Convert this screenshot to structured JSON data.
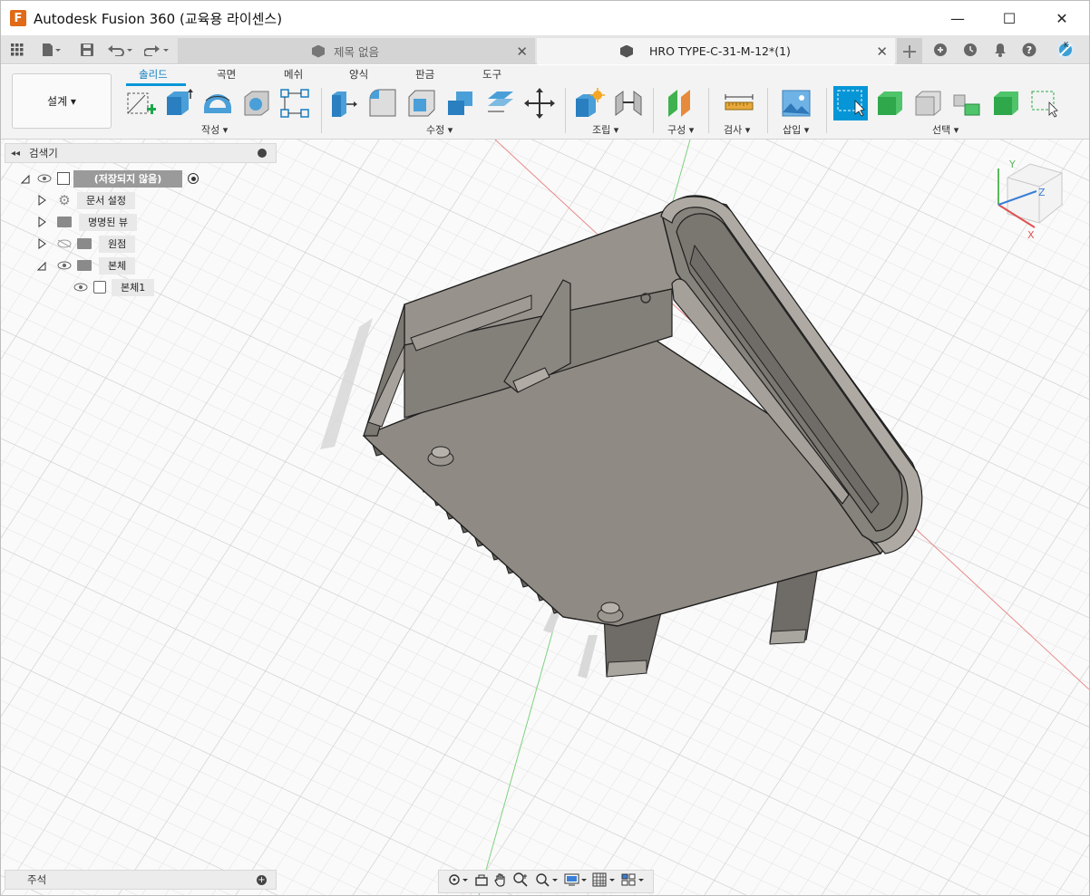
{
  "window": {
    "title": "Autodesk Fusion 360 (교육용 라이센스)",
    "logo_letter": "F",
    "minimize": "—",
    "maximize": "☐",
    "close": "✕"
  },
  "tabs": [
    {
      "label": "제목 없음"
    },
    {
      "label": "HRO  TYPE-C-31-M-12*(1)"
    }
  ],
  "tab_close_glyph": "✕",
  "workspace": {
    "label": "설계 ▾"
  },
  "toolbar_tabs": [
    "솔리드",
    "곡면",
    "메쉬",
    "양식",
    "판금",
    "도구"
  ],
  "toolbar_groups": {
    "create": "작성 ▾",
    "modify": "수정 ▾",
    "assemble": "조립 ▾",
    "construct": "구성 ▾",
    "inspect": "검사 ▾",
    "insert": "삽입 ▾",
    "select": "선택 ▾"
  },
  "browser": {
    "title": "검색기",
    "root": "(저장되지 않음)",
    "items": [
      "문서 설정",
      "명명된 뷰",
      "원점",
      "본체",
      "본체1"
    ]
  },
  "comments": {
    "title": "주석"
  },
  "viewcube": {
    "axis_x": "X",
    "axis_y": "Y",
    "axis_z": "Z"
  },
  "colors": {
    "accent": "#0696d7",
    "body": "#8f8a83",
    "axis_x": "#d94a4a",
    "axis_y": "#4ab54a"
  }
}
